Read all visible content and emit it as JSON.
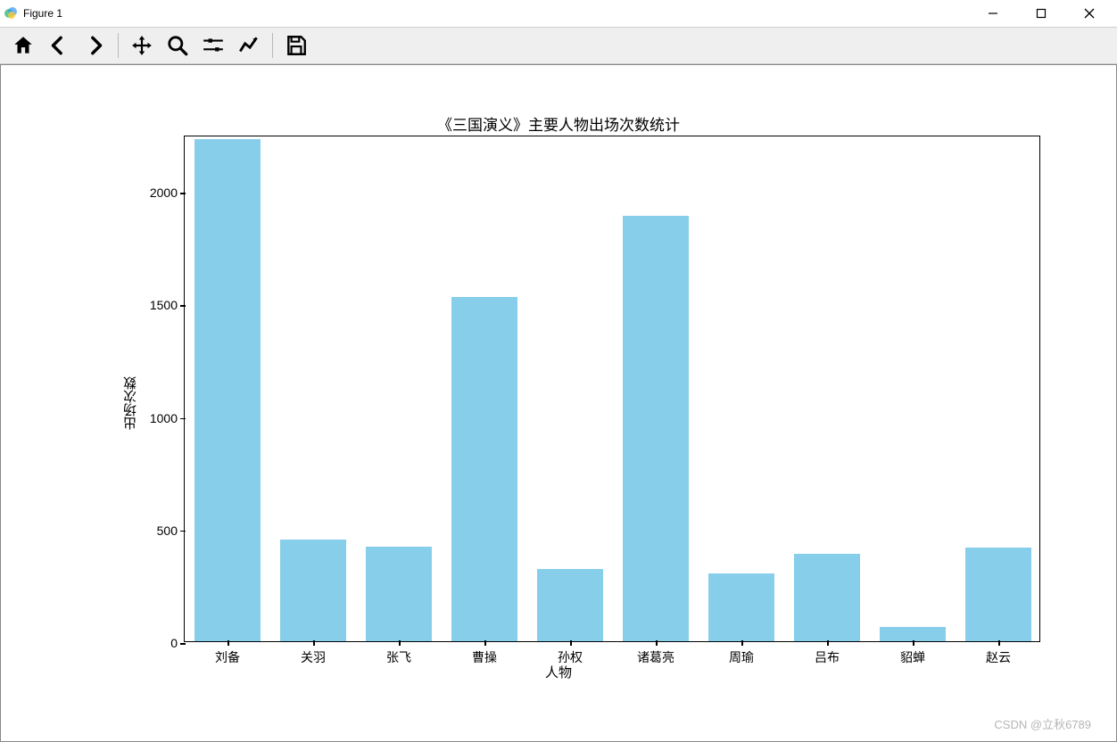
{
  "window": {
    "title": "Figure 1"
  },
  "toolbar": {
    "home": "home-icon",
    "back": "back-icon",
    "forward": "forward-icon",
    "pan": "pan-icon",
    "zoom": "zoom-icon",
    "subplots": "subplots-icon",
    "axes": "axes-icon",
    "save": "save-icon"
  },
  "chart_data": {
    "type": "bar",
    "title": "《三国演义》主要人物出场次数统计",
    "xlabel": "人物",
    "ylabel": "出场次数",
    "categories": [
      "刘备",
      "关羽",
      "张飞",
      "曹操",
      "孙权",
      "诸葛亮",
      "周瑜",
      "吕布",
      "貂蝉",
      "赵云"
    ],
    "values": [
      2230,
      450,
      420,
      1530,
      320,
      1890,
      300,
      390,
      65,
      415
    ],
    "yticks": [
      0,
      500,
      1000,
      1500,
      2000
    ],
    "ylim": [
      0,
      2250
    ],
    "bar_color": "#87ceeb"
  },
  "watermark": "CSDN @立秋6789"
}
